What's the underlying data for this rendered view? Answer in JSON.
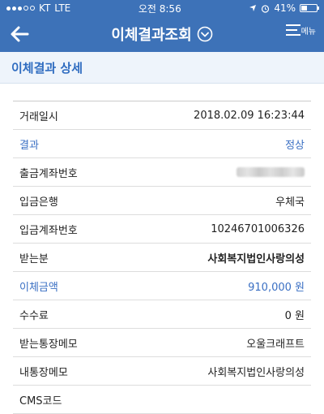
{
  "status_bar": {
    "carrier": "KT",
    "network": "LTE",
    "time": "오전 8:56",
    "battery": "41%",
    "battery_level": 0.41
  },
  "header": {
    "title": "이체결과조회",
    "menu_label": "메뉴"
  },
  "section_title": "이체결과 상세",
  "rows": [
    {
      "label": "거래일시",
      "value": "2018.02.09 16:23:44"
    },
    {
      "label": "결과",
      "value": "정상"
    },
    {
      "label": "출금계좌번호",
      "value": ""
    },
    {
      "label": "입금은행",
      "value": "우체국"
    },
    {
      "label": "입금계좌번호",
      "value": "10246701006326"
    },
    {
      "label": "받는분",
      "value": "사회복지법인사랑의성"
    },
    {
      "label": "이체금액",
      "value": "910,000 원"
    },
    {
      "label": "수수료",
      "value": "0 원"
    },
    {
      "label": "받는통장메모",
      "value": "오울크래프트"
    },
    {
      "label": "내통장메모",
      "value": "사회복지법인사랑의성"
    },
    {
      "label": "CMS코드",
      "value": ""
    }
  ],
  "colors": {
    "primary": "#3d72b8",
    "accent_text": "#3a6fc3"
  }
}
